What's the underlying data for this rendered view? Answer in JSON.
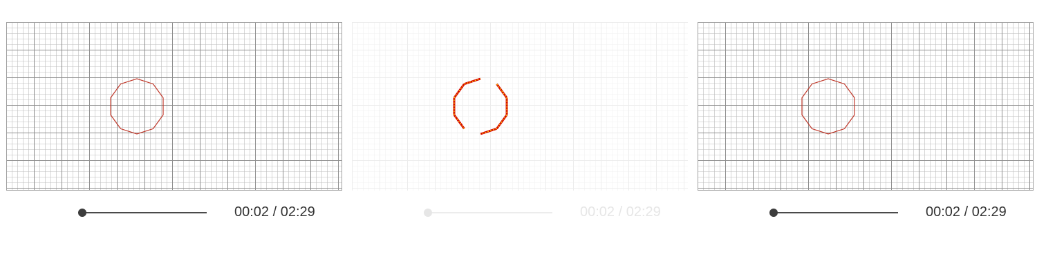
{
  "panels": [
    {
      "id": "left",
      "view": "grid-with-polygon",
      "shape": "decagon",
      "shape_color": "#c0392b",
      "player": {
        "time_text": "00:02 / 02:29",
        "progress": 0.0
      }
    },
    {
      "id": "middle",
      "view": "difference-highlight",
      "shape": "decagon-edges",
      "highlight_colors": [
        "#d40000",
        "#ffe600"
      ],
      "player": {
        "time_text": "00:02 / 02:29",
        "progress": 0.0
      }
    },
    {
      "id": "right",
      "view": "grid-with-polygon",
      "shape": "decagon",
      "shape_color": "#c0392b",
      "player": {
        "time_text": "00:02 / 02:29",
        "progress": 0.0
      }
    }
  ]
}
